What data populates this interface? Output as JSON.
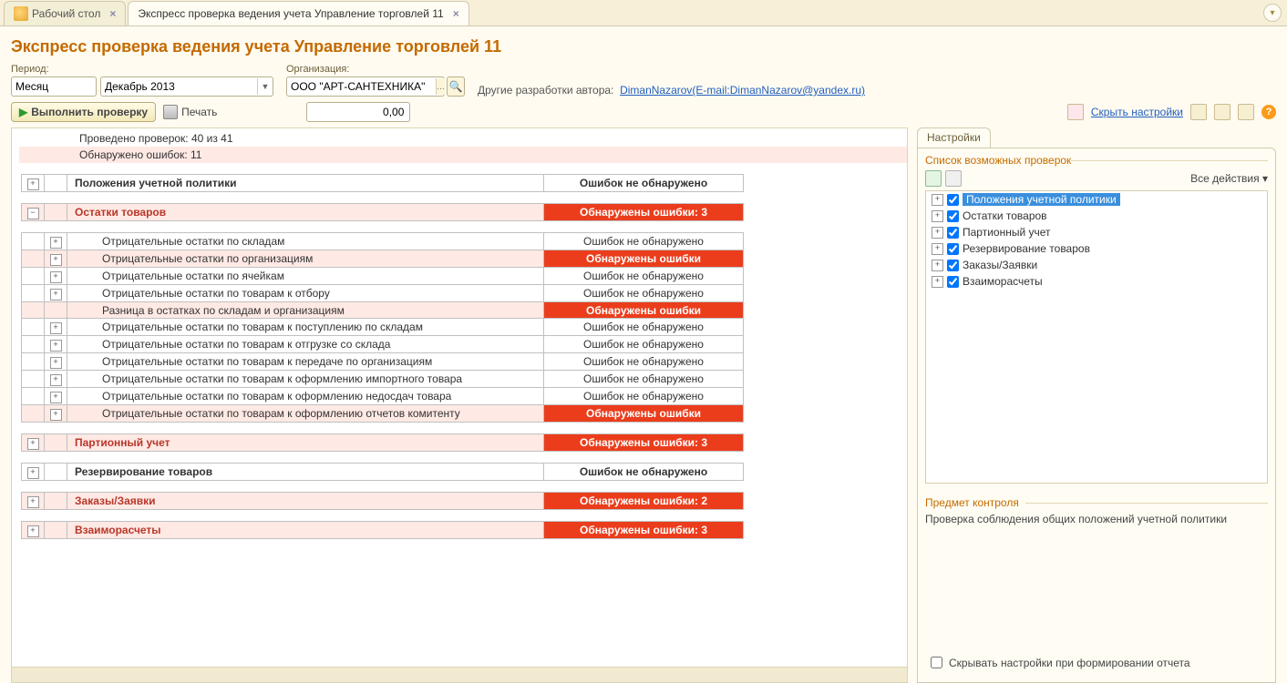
{
  "tabs": {
    "desktop": "Рабочий стол",
    "active": "Экспресс проверка ведения учета Управление торговлей 11"
  },
  "title": "Экспресс проверка ведения учета Управление торговлей 11",
  "labels": {
    "period": "Период:",
    "org": "Организация:",
    "author": "Другие разработки автора:",
    "author_link": "DimanNazarov(E-mail:DimanNazarov@yandex.ru)"
  },
  "period_type": "Месяц",
  "period_value": "Декабрь 2013",
  "org_value": "ООО \"АРТ-САНТЕХНИКА\"",
  "toolbar": {
    "run": "Выполнить проверку",
    "print": "Печать",
    "num": "0,00",
    "hide": "Скрыть настройки"
  },
  "summary": {
    "done": "Проведено проверок: 40 из 41",
    "errors": "Обнаружено ошибок: 11"
  },
  "stat": {
    "ok": "Ошибок не обнаружено",
    "err": "Обнаружены ошибки",
    "e3": "Обнаружены ошибки: 3",
    "e2": "Обнаружены ошибки: 2"
  },
  "groups": {
    "g1": "Положения учетной политики",
    "g2": "Остатки товаров",
    "g3": "Партионный учет",
    "g4": "Резервирование товаров",
    "g5": "Заказы/Заявки",
    "g6": "Взаиморасчеты"
  },
  "subs": {
    "s1": "Отрицательные остатки по складам",
    "s2": "Отрицательные остатки по организациям",
    "s3": "Отрицательные остатки по ячейкам",
    "s4": "Отрицательные остатки по товарам к отбору",
    "s5": "Разница в остатках по складам и организациям",
    "s6": "Отрицательные остатки по товарам к поступлению по складам",
    "s7": "Отрицательные остатки по товарам к отгрузке со склада",
    "s8": "Отрицательные остатки по товарам к передаче по организациям",
    "s9": "Отрицательные остатки по товарам к оформлению импортного товара",
    "s10": "Отрицательные остатки по товарам к оформлению недосдач товара",
    "s11": "Отрицательные остатки по товарам к оформлению отчетов комитенту"
  },
  "side": {
    "tab": "Настройки",
    "list_title": "Список возможных проверок",
    "all_actions": "Все действия ▾",
    "subject_title": "Предмет контроля",
    "subject_text": "Проверка соблюдения общих положений учетной политики",
    "hide_on_gen": "Скрывать настройки при формировании отчета"
  },
  "tree": [
    "Положения учетной политики",
    "Остатки товаров",
    "Партионный учет",
    "Резервирование товаров",
    "Заказы/Заявки",
    "Взаиморасчеты"
  ]
}
